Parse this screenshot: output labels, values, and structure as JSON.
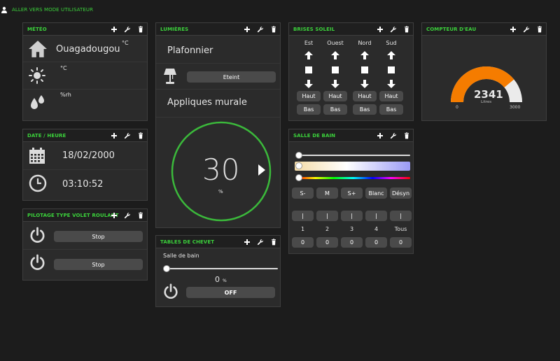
{
  "topbar": {
    "link": "ALLER VERS MODE UTILISATEUR"
  },
  "meteo": {
    "title": "MÉTÉO",
    "city": "Ouagadougou",
    "temp_unit": "°C",
    "temp2_unit": "°C",
    "humidity_unit": "%rh"
  },
  "lumieres": {
    "title": "LUMIÈRES",
    "plafonnier": "Plafonnier",
    "state": "Eteint",
    "appliques": "Appliques murale",
    "dial_value": "30",
    "dial_unit": "%",
    "dial_level": 30
  },
  "brises": {
    "title": "BRISES SOLEIL",
    "columns": [
      {
        "name": "Est",
        "haut": "Haut",
        "bas": "Bas"
      },
      {
        "name": "Ouest",
        "haut": "Haut",
        "bas": "Bas"
      },
      {
        "name": "Nord",
        "haut": "Haut",
        "bas": "Bas"
      },
      {
        "name": "Sud",
        "haut": "Haut",
        "bas": "Bas"
      }
    ]
  },
  "compteur": {
    "title": "COMPTEUR D'EAU",
    "value": "2341",
    "unit": "Litres",
    "min": "0",
    "max": "3000",
    "fraction": 0.78,
    "fill_color": "#f57c00"
  },
  "date": {
    "title": "DATE / HEURE",
    "date": "18/02/2000",
    "time": "03:10:52"
  },
  "volet": {
    "title": "PILOTAGE TYPE VOLET ROULANT",
    "stop1": "Stop",
    "stop2": "Stop"
  },
  "sdb": {
    "title": "SALLE DE BAIN",
    "buttons": [
      "S-",
      "M",
      "S+",
      "Blanc",
      "Désyn"
    ],
    "bar_label": "|",
    "channels": [
      "1",
      "2",
      "3",
      "4",
      "Tous"
    ],
    "values": [
      "0",
      "0",
      "0",
      "0",
      "0"
    ]
  },
  "chevet": {
    "title": "TABLES DE CHEVET",
    "label": "Salle de bain",
    "value": "0",
    "unit": "%",
    "off": "OFF"
  },
  "colors": {
    "accent": "#3bd13b",
    "dial": "#3bb93b"
  }
}
